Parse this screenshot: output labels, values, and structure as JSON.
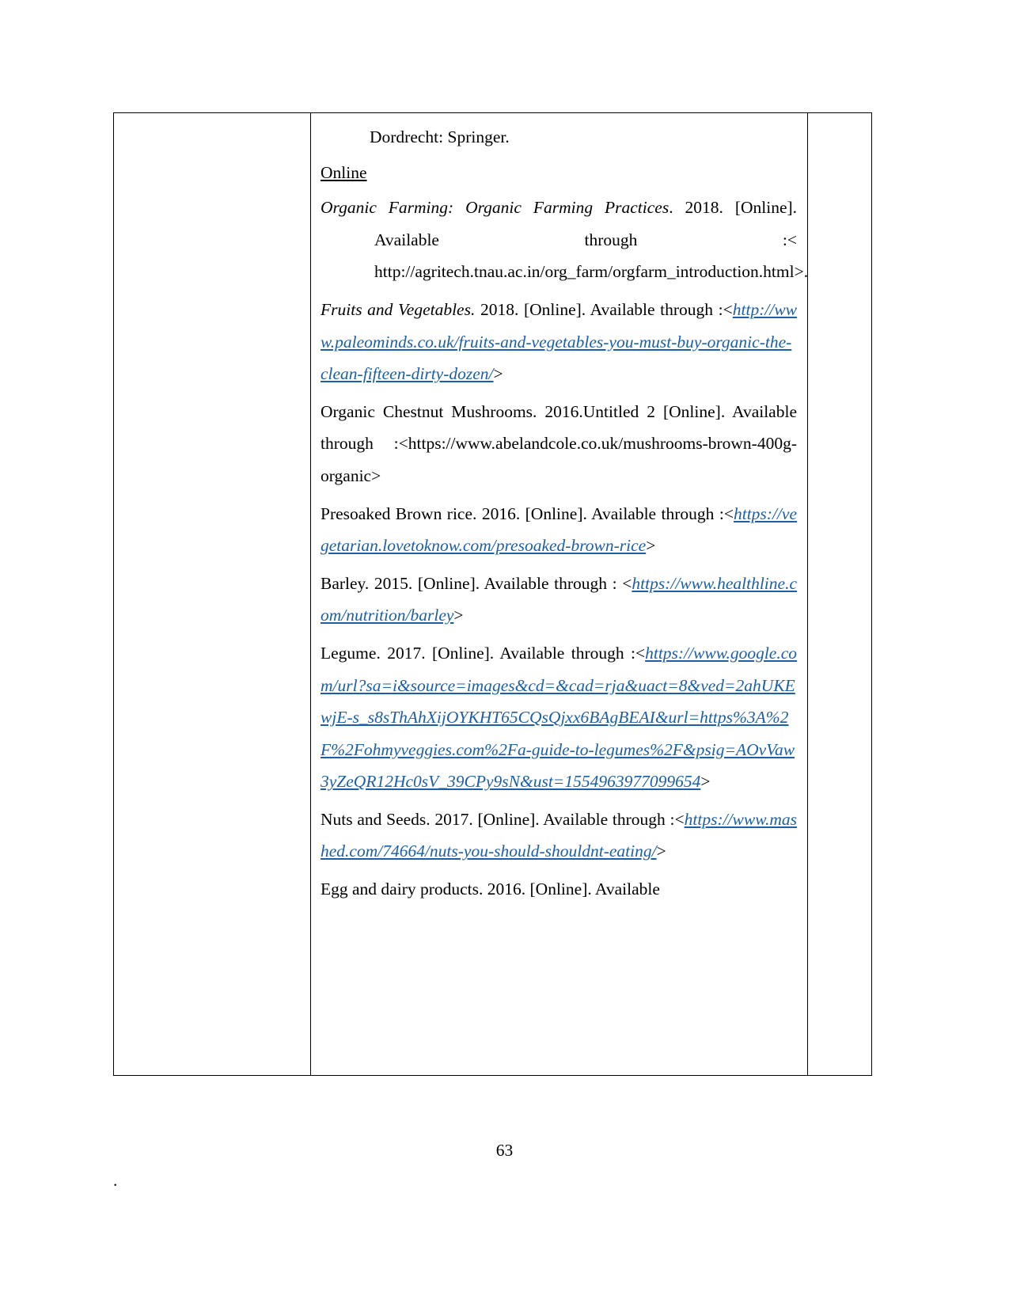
{
  "document": {
    "page_number": "63",
    "footer_mark": ".",
    "link_color": "#1a5fa8"
  },
  "table": {
    "columns": [
      "",
      "references-content",
      ""
    ],
    "left_cell": "",
    "right_cell": ""
  },
  "references": {
    "continuation_line": "Dordrecht: Springer.",
    "section_heading": "Online",
    "entries": [
      {
        "id": "organic-farming",
        "title_italic": "Organic Farming: Organic Farming Practices",
        "rest_line1": ". 2018.",
        "line2": "[Online].  Available  through  :<",
        "url_plain": "http://agritech.tnau.ac.in/org_farm/orgfarm_introduction.html",
        "closing": ">."
      },
      {
        "id": "fruits-and-vegetables",
        "title_italic": "Fruits and Vegetables.",
        "rest": " 2018.  [Online].  Available through  :<",
        "url_link": "http://www.paleominds.co.uk/fruits-and-vegetables-you-must-buy-organic-the-clean-fifteen-dirty-dozen/",
        "closing": ">"
      },
      {
        "id": "organic-chestnut-mushrooms",
        "text_before": "Organic  Chestnut  Mushrooms.  2016.Untitled  2  [Online]. Available                                through :<",
        "url_plain": "https://www.abelandcole.co.uk/mushrooms-brown-400g-organic",
        "closing": ">"
      },
      {
        "id": "presoaked-brown-rice",
        "text_before": "Presoaked  Brown  rice.  2016.  [Online].  Available through           :<",
        "url_link": "https://vegetarian.lovetoknow.com/presoaked-brown-rice",
        "closing": ">"
      },
      {
        "id": "barley",
        "text_before": "Barley.  2015.  [Online].  Available  through  : <",
        "url_link": "https://www.healthline.com/nutrition/barley",
        "closing": ">"
      },
      {
        "id": "legume",
        "text_before": "Legume.  2017.  [Online].  Available through                        :<",
        "url_link": "https://www.google.com/url?sa=i&source=images&cd=&cad=rja&uact=8&ved=2ahUKEwjE-s_s8sThAhXijOYKHT65CQsQjxx6BAgBEAI&url=https%3A%2F%2Fohmyveggies.com%2Fa-guide-to-legumes%2F&psig=AOvVaw3yZeQR12Hc0sV_39CPy9sN&ust=1554963977099654",
        "closing": ">"
      },
      {
        "id": "nuts-and-seeds",
        "text_before": "Nuts  and  Seeds.  2017.  [Online].  Available through     :<",
        "url_link": "https://www.mashed.com/74664/nuts-you-should-shouldnt-eating/",
        "closing": ">"
      },
      {
        "id": "egg-and-dairy-products",
        "text_before": "Egg  and  dairy  products.  2016.  [Online].  Available"
      }
    ]
  }
}
